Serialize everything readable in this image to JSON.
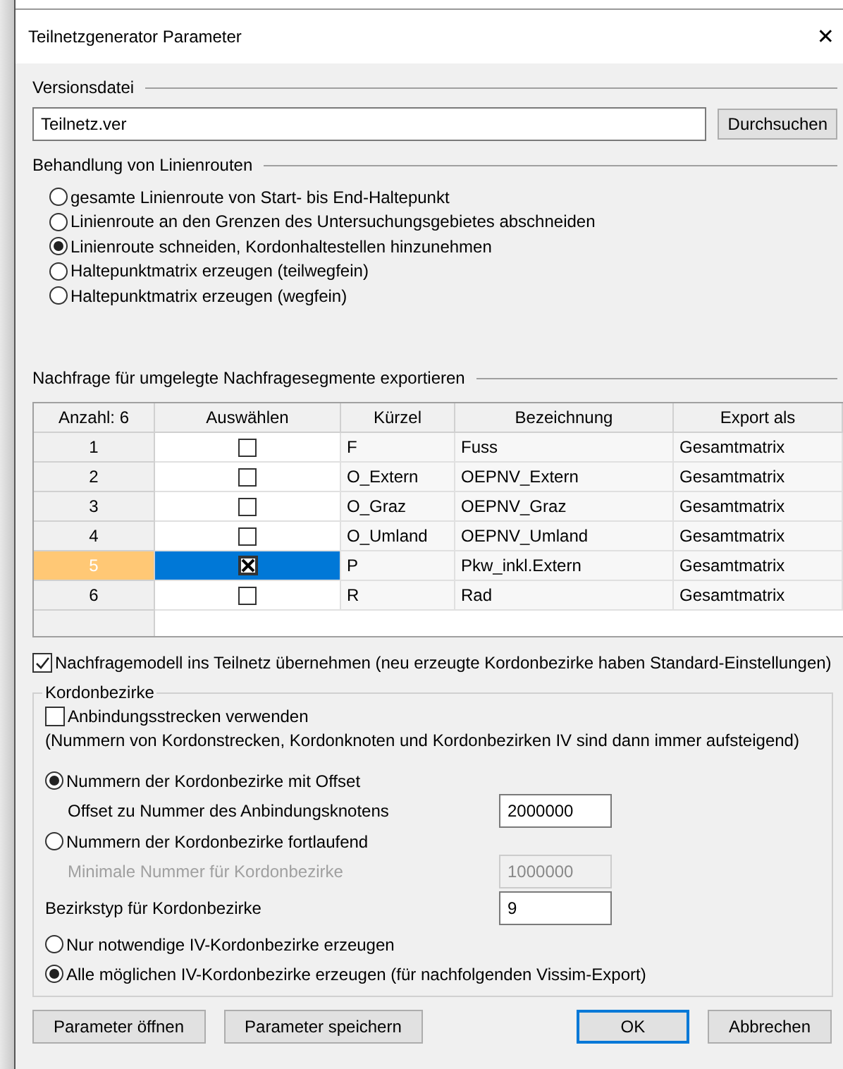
{
  "window": {
    "title": "Teilnetzgenerator Parameter",
    "close": "✕"
  },
  "version_file": {
    "heading": "Versionsdatei",
    "value": "Teilnetz.ver",
    "browse": "Durchsuchen"
  },
  "line_routes": {
    "heading": "Behandlung von Linienrouten",
    "options": [
      {
        "label": "gesamte Linienroute von Start- bis End-Haltepunkt",
        "selected": false
      },
      {
        "label": "Linienroute an den Grenzen des Untersuchungsgebietes abschneiden",
        "selected": false
      },
      {
        "label": "Linienroute schneiden, Kordonhaltestellen hinzunehmen",
        "selected": true
      },
      {
        "label": "Haltepunktmatrix erzeugen (teilwegfein)",
        "selected": false
      },
      {
        "label": "Haltepunktmatrix erzeugen (wegfein)",
        "selected": false
      }
    ]
  },
  "demand": {
    "heading": "Nachfrage für umgelegte Nachfragesegmente exportieren",
    "table": {
      "columns": [
        "Anzahl: 6",
        "Auswählen",
        "Kürzel",
        "Bezeichnung",
        "Export als"
      ],
      "rows": [
        {
          "number": "1",
          "checked": false,
          "selected": false,
          "code": "F",
          "name": "Fuss",
          "export": "Gesamtmatrix"
        },
        {
          "number": "2",
          "checked": false,
          "selected": false,
          "code": "O_Extern",
          "name": "OEPNV_Extern",
          "export": "Gesamtmatrix"
        },
        {
          "number": "3",
          "checked": false,
          "selected": false,
          "code": "O_Graz",
          "name": "OEPNV_Graz",
          "export": "Gesamtmatrix"
        },
        {
          "number": "4",
          "checked": false,
          "selected": false,
          "code": "O_Umland",
          "name": "OEPNV_Umland",
          "export": "Gesamtmatrix"
        },
        {
          "number": "5",
          "checked": true,
          "selected": true,
          "code": "P",
          "name": "Pkw_inkl.Extern",
          "export": "Gesamtmatrix"
        },
        {
          "number": "6",
          "checked": false,
          "selected": false,
          "code": "R",
          "name": "Rad",
          "export": "Gesamtmatrix"
        }
      ]
    },
    "adopt": {
      "label": "Nachfragemodell ins Teilnetz übernehmen (neu erzeugte Kordonbezirke haben Standard-Einstellungen)",
      "checked": true
    }
  },
  "cordon": {
    "heading": "Kordonbezirke",
    "connectors": {
      "label": "Anbindungsstrecken verwenden",
      "checked": false,
      "note": "(Nummern von Kordonstrecken, Kordonknoten und Kordonbezirken IV sind dann immer aufsteigend)"
    },
    "numbering": [
      {
        "label": "Nummern der Kordonbezirke mit Offset",
        "selected": true,
        "field_label": "Offset zu Nummer des Anbindungsknotens",
        "value": "2000000",
        "disabled": false
      },
      {
        "label": "Nummern der Kordonbezirke fortlaufend",
        "selected": false,
        "field_label": "Minimale Nummer für Kordonbezirke",
        "value": "1000000",
        "disabled": true
      }
    ],
    "zone_type": {
      "label": "Bezirkstyp für Kordonbezirke",
      "value": "9"
    },
    "generation": [
      {
        "label": "Nur notwendige IV-Kordonbezirke erzeugen",
        "selected": false
      },
      {
        "label": "Alle möglichen IV-Kordonbezirke erzeugen (für nachfolgenden Vissim-Export)",
        "selected": true
      }
    ]
  },
  "buttons": [
    {
      "label": "Parameter öffnen",
      "default": false
    },
    {
      "label": "Parameter speichern",
      "default": false
    },
    {
      "label": "OK",
      "default": true
    },
    {
      "label": "Abbrechen",
      "default": false
    }
  ]
}
